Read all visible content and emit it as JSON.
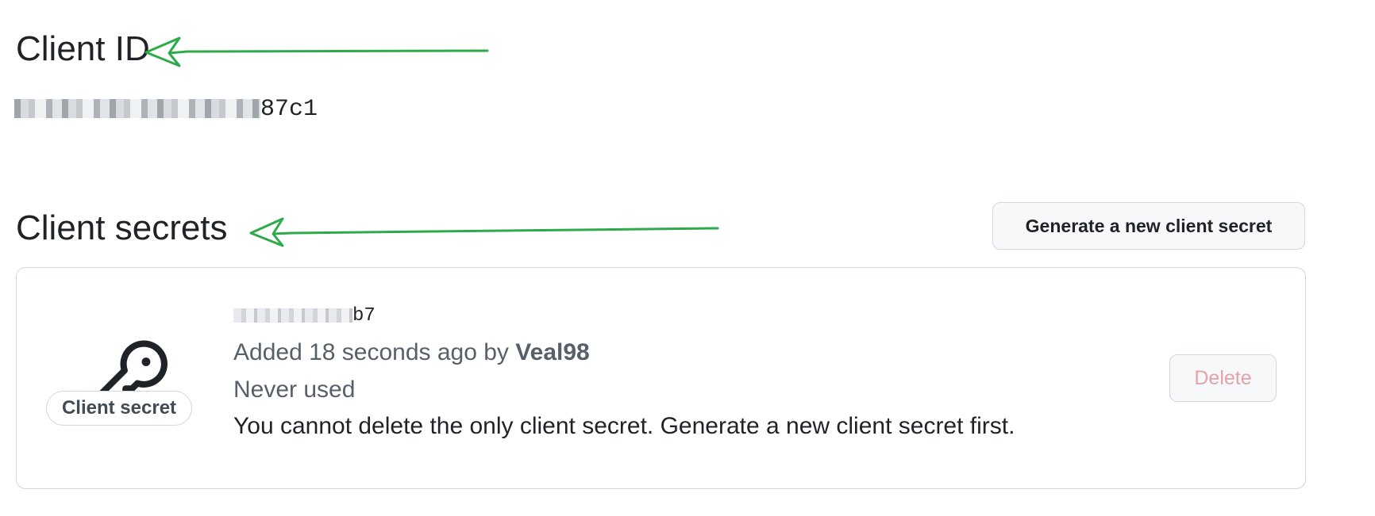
{
  "client_id": {
    "heading": "Client ID",
    "value_visible_suffix": "87c1"
  },
  "client_secrets": {
    "heading": "Client secrets",
    "generate_button_label": "Generate a new client secret",
    "secret": {
      "badge_label": "Client secret",
      "masked_visible_suffix": "b7",
      "added_prefix": "Added 18 seconds ago by ",
      "added_by": "Veal98",
      "usage": "Never used",
      "warning": "You cannot delete the only client secret. Generate a new client secret first.",
      "delete_label": "Delete",
      "delete_disabled": true
    }
  },
  "annotations": {
    "arrow_color": "#2eaa4a"
  },
  "colors": {
    "text_primary": "#1f2328",
    "text_muted": "#57606a",
    "border": "#d0d7de",
    "button_bg": "#f6f8fa",
    "danger_disabled": "#e3a3a9"
  }
}
